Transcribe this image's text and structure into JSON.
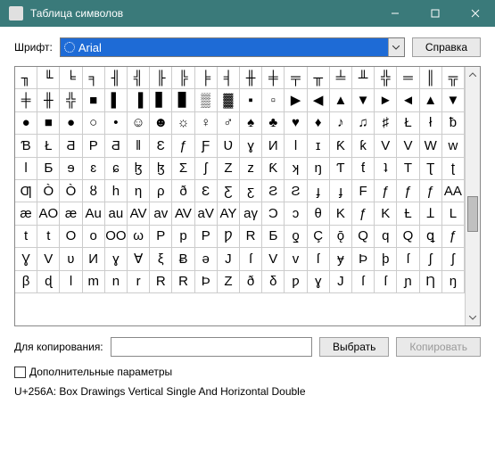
{
  "window": {
    "title": "Таблица символов"
  },
  "labels": {
    "font": "Шрифт:",
    "help": "Справка",
    "copyFor": "Для копирования:",
    "select": "Выбрать",
    "copy": "Копировать",
    "advanced": "Дополнительные параметры"
  },
  "font": {
    "selected": "Arial"
  },
  "copyInput": "",
  "status": "U+256A: Box Drawings Vertical Single And Horizontal Double",
  "chars": [
    "╖",
    "╙",
    "╘",
    "╕",
    "╢",
    "╣",
    "╟",
    "╠",
    "╞",
    "╡",
    "╫",
    "╪",
    "╤",
    "╥",
    "╧",
    "╨",
    "╬",
    "═",
    "║",
    "╦",
    "╪",
    "╫",
    "╬",
    "■",
    "▌",
    "▐",
    "▋",
    "▊",
    "▒",
    "▓",
    "▪",
    "▫",
    "▶",
    "◀",
    "▲",
    "▼",
    "►",
    "◄",
    "▲",
    "▼",
    "●",
    "■",
    "●",
    "○",
    "•",
    "☺",
    "☻",
    "☼",
    "♀",
    "♂",
    "♠",
    "♣",
    "♥",
    "♦",
    "♪",
    "♫",
    "♯",
    "Ł",
    "ł",
    "ƀ",
    "Ɓ",
    "Ł",
    "Ƌ",
    "P",
    "Ƌ",
    "ǁ",
    "Ɛ",
    "ƒ",
    "Ƒ",
    "Ʋ",
    "ɣ",
    "И",
    "Ɩ",
    "ɪ",
    "Ƙ",
    "ƙ",
    "V",
    "V",
    "W",
    "w",
    "ǀ",
    "Ƃ",
    "ɘ",
    "ɛ",
    "ɕ",
    "ɮ",
    "ɮ",
    "Ʃ",
    "ʃ",
    "Z",
    "z",
    "Ƙ",
    "ʞ",
    "ŋ",
    "Ƭ",
    "ƭ",
    "ʇ",
    "T",
    "Ʈ",
    "ʈ",
    "Ƣ",
    "Ò",
    "Ò",
    "ȣ",
    "h",
    "η",
    "ρ",
    "ð",
    "Ɛ",
    "Ƹ",
    "ƹ",
    "Ƨ",
    "Ƨ",
    "ɟ",
    "ɟ",
    "F",
    "ƒ",
    "ƒ",
    "ƒ",
    "AA",
    "æ",
    "AO",
    "æ",
    "Au",
    "au",
    "AV",
    "av",
    "AV",
    "aV",
    "AY",
    "aγ",
    "Ɔ",
    "ɔ",
    "θ",
    "K",
    "ƒ",
    "K",
    "Ƚ",
    "Ʇ",
    "L",
    "t",
    "t",
    "O",
    "o",
    "OO",
    "ω",
    "P",
    "p",
    "P",
    "Ƿ",
    "R",
    "Ƃ",
    "ƍ",
    "Ç",
    "ǭ",
    "Q",
    "q",
    "Q",
    "ꝗ",
    "ƒ",
    "Ɣ",
    "V",
    "ʋ",
    "И",
    "ɣ",
    "Ɐ",
    "ξ",
    "Ƀ",
    "ǝ",
    "J",
    "ſ",
    "V",
    "v",
    "ſ",
    "ɏ",
    "Þ",
    "þ",
    "ſ",
    "ʃ",
    "ʃ",
    "β",
    "ɖ",
    "l",
    "m",
    "n",
    "r",
    "R",
    "R",
    "Þ",
    "Z",
    "ð",
    "δ",
    "ƿ",
    "ɣ",
    "J",
    "ſ",
    "ſ",
    "ɲ",
    "Ƞ",
    "ŋ"
  ]
}
